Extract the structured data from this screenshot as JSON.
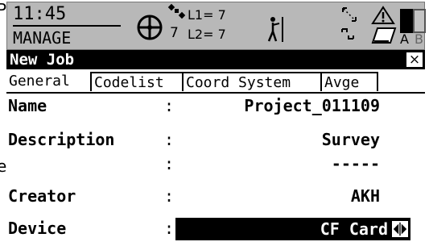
{
  "status": {
    "time": "11:45",
    "mode": "MANAGE",
    "satellites": "7",
    "l1": "L1= 7",
    "l2": "L2= 7",
    "battery_a": "A",
    "battery_b": "B",
    "battery_a_level": 1.0,
    "battery_b_level": 0.0
  },
  "dialog": {
    "title": "New Job",
    "close": "×"
  },
  "tabs": [
    {
      "label": "General",
      "active": true
    },
    {
      "label": "Codelist",
      "active": false
    },
    {
      "label": "Coord System",
      "active": false
    },
    {
      "label": "Avge",
      "active": false
    }
  ],
  "fields": {
    "name": {
      "label": "Name",
      "colon": ":",
      "value": "Project_011109"
    },
    "description": {
      "label": "Description",
      "colon": ":",
      "value": "Survey"
    },
    "description2": {
      "colon": ":",
      "value": "-----"
    },
    "creator": {
      "label": "Creator",
      "colon": ":",
      "value": "AKH"
    },
    "device": {
      "label": "Device",
      "colon": ":",
      "value": "CF Card"
    }
  },
  "edge_glyphs": [
    "P",
    "e"
  ]
}
